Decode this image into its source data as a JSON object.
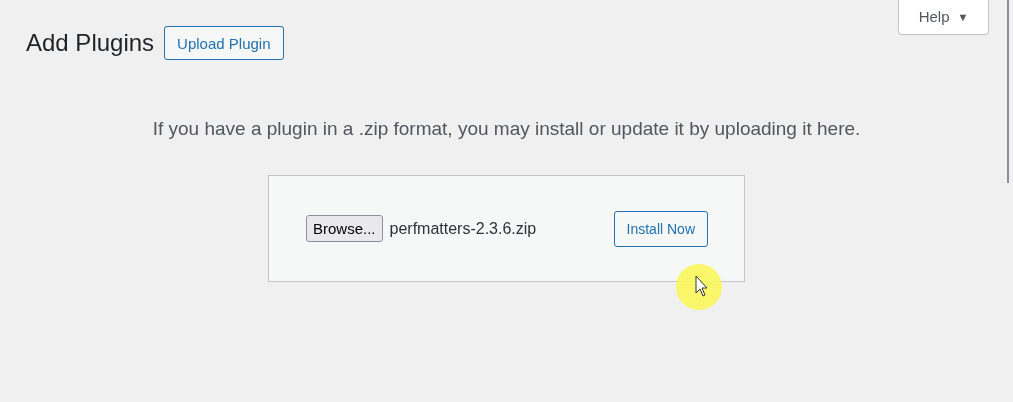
{
  "header": {
    "title": "Add Plugins",
    "upload_button": "Upload Plugin"
  },
  "help_tab": {
    "label": "Help",
    "caret": "▼"
  },
  "description": "If you have a plugin in a .zip format, you may install or update it by uploading it here.",
  "upload_form": {
    "browse_button": "Browse...",
    "file_name": "perfmatters-2.3.6.zip",
    "install_button": "Install Now"
  }
}
